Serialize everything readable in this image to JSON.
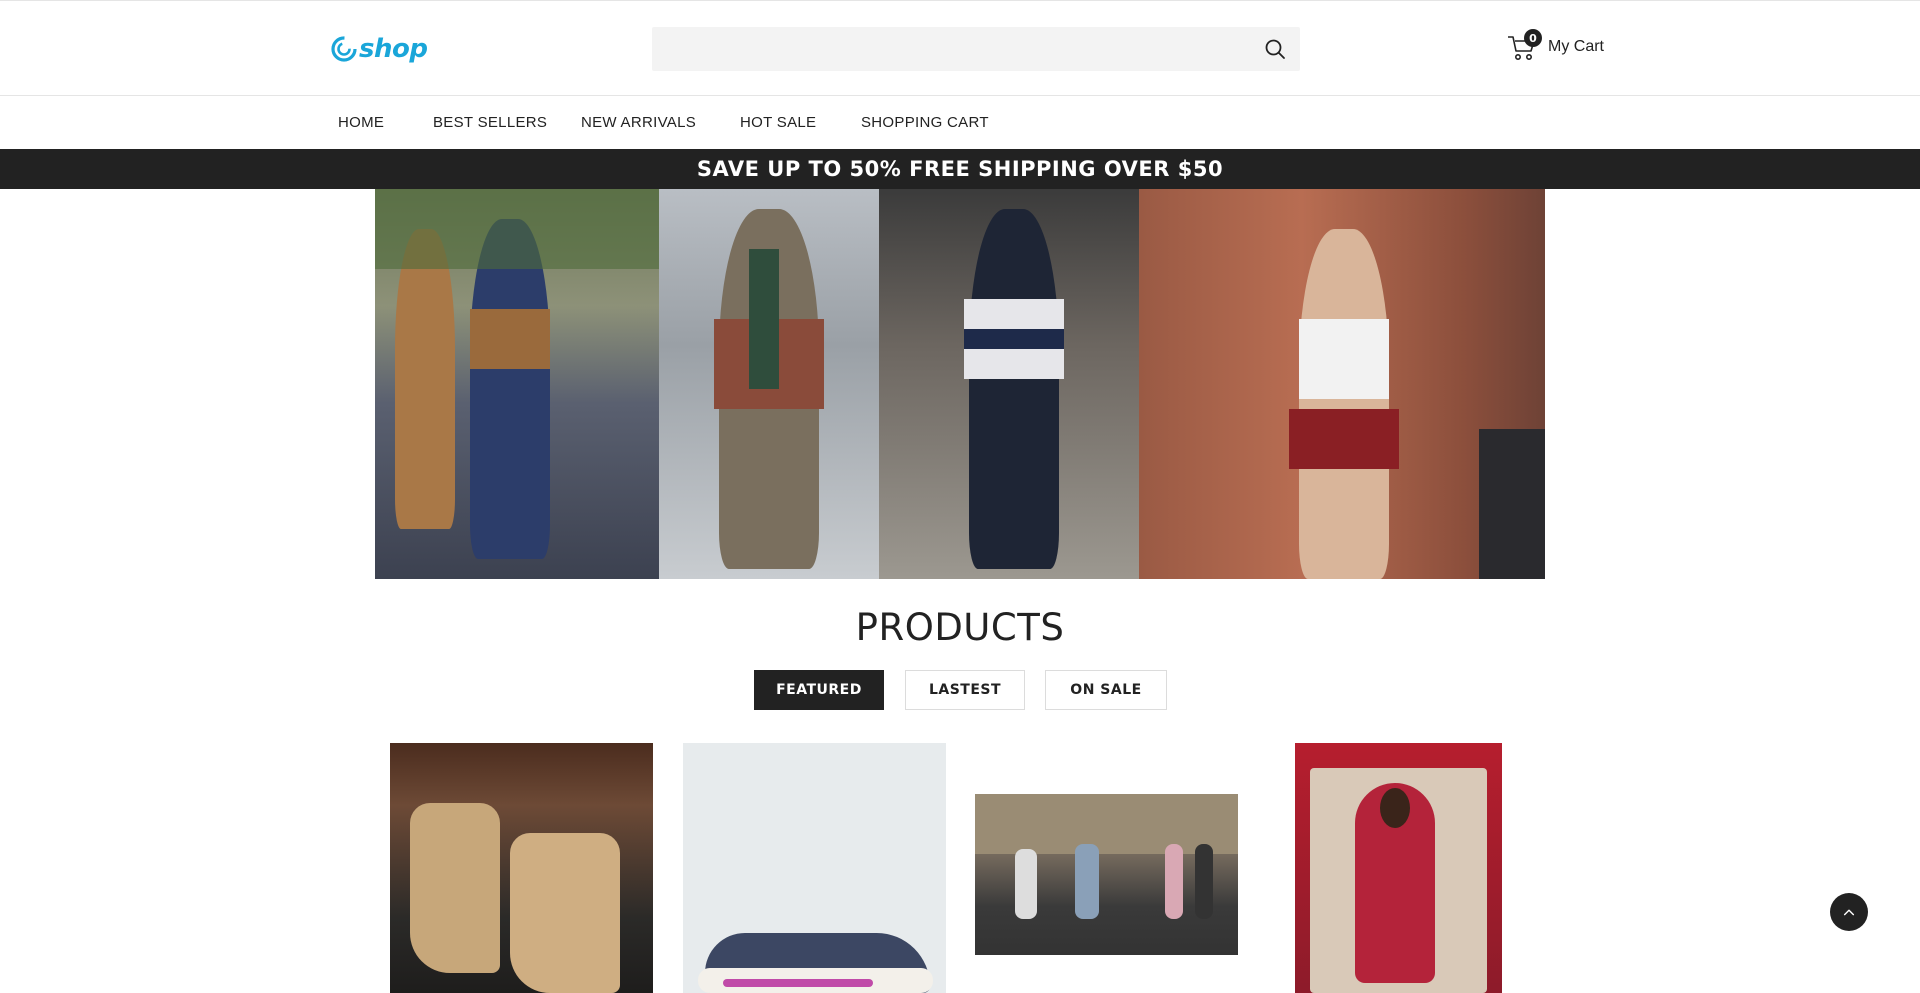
{
  "header": {
    "logo_text": "shop",
    "search": {
      "placeholder": "",
      "value": ""
    },
    "cart": {
      "count": "0",
      "label": "My Cart"
    }
  },
  "nav": {
    "items": [
      "HOME",
      "BEST SELLERS",
      "NEW ARRIVALS",
      "HOT SALE",
      "SHOPPING CART"
    ]
  },
  "promo": {
    "text": "SAVE UP TO 50% FREE SHIPPING OVER $50"
  },
  "products": {
    "title": "PRODUCTS",
    "tabs": [
      "FEATURED",
      "LASTEST",
      "ON SALE"
    ],
    "active_tab": "FEATURED"
  },
  "icons": {
    "logo": "swirl-logo-icon",
    "search": "search-icon",
    "cart": "cart-icon",
    "back_to_top": "chevron-up-icon"
  },
  "colors": {
    "brand": "#1aa6d9",
    "dark": "#222222",
    "search_bg": "#f3f3f3"
  }
}
